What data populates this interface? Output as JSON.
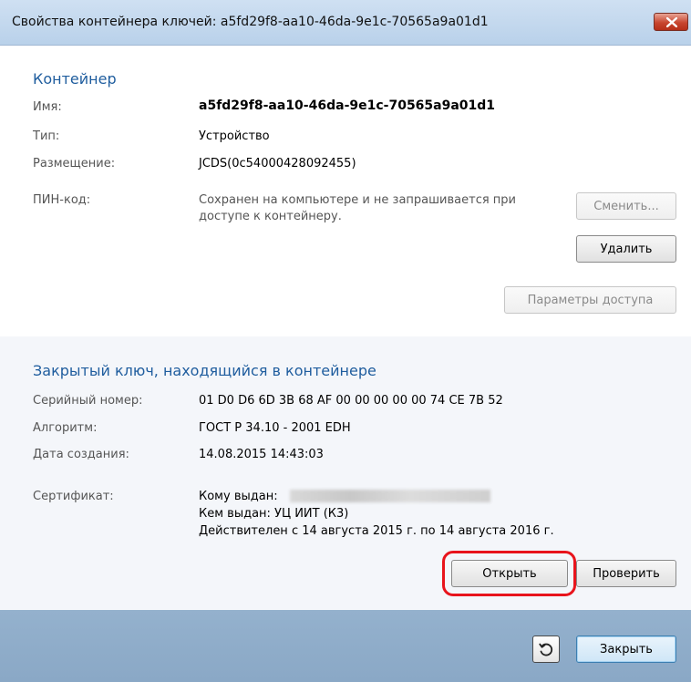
{
  "window": {
    "title": "Свойства контейнера ключей: a5fd29f8-aa10-46da-9e1c-70565a9a01d1"
  },
  "container": {
    "section_title": "Контейнер",
    "name_label": "Имя:",
    "name_value": "a5fd29f8-aa10-46da-9e1c-70565a9a01d1",
    "type_label": "Тип:",
    "type_value": "Устройство",
    "location_label": "Размещение:",
    "location_value": "JCDS(0c54000428092455)",
    "pin_label": "ПИН-код:",
    "pin_line1": "Сохранен на компьютере и не запрашивается при",
    "pin_line2": "доступе к контейнеру.",
    "change_button": "Сменить...",
    "delete_button": "Удалить",
    "access_button": "Параметры доступа"
  },
  "private_key": {
    "section_title": "Закрытый ключ, находящийся в контейнере",
    "serial_label": "Серийный номер:",
    "serial_value": "01 D0 D6 6D 3B 68 AF 00 00 00 00 00 74 CE 7B 52",
    "algorithm_label": "Алгоритм:",
    "algorithm_value": "ГОСТ Р 34.10 - 2001 EDH",
    "created_label": "Дата создания:",
    "created_value": "14.08.2015 14:43:03",
    "certificate_label": "Сертификат:",
    "issued_to": "Кому выдан:",
    "issued_by": "Кем выдан: УЦ ИИТ (К3)",
    "validity": "Действителен с 14 августа 2015 г. по 14 августа 2016 г.",
    "open_button": "Открыть",
    "verify_button": "Проверить"
  },
  "footer": {
    "close_button": "Закрыть"
  },
  "colors": {
    "section_title": "#1f5d9e",
    "highlight": "#e8141c",
    "footer": "#8faecb"
  },
  "icons": [
    "close-icon",
    "refresh-icon"
  ]
}
